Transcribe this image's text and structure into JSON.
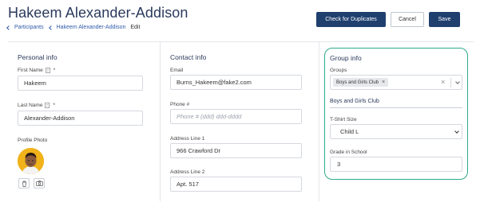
{
  "header": {
    "title": "Hakeem Alexander-Addison",
    "breadcrumb": {
      "participants": "Participants",
      "person": "Hakeem Alexander-Addison",
      "current": "Edit"
    }
  },
  "toolbar": {
    "check_duplicates": "Check for Duplicates",
    "cancel": "Cancel",
    "save": "Save"
  },
  "personal": {
    "title": "Personal info",
    "first_name_label": "First Name",
    "first_name_value": "Hakeem",
    "last_name_label": "Last Name",
    "last_name_value": "Alexander-Addison",
    "required_mark": "*",
    "photo_label": "Profile Photo"
  },
  "contact": {
    "title": "Contact info",
    "email_label": "Email",
    "email_value": "Burns_Hakeem@fake2.com",
    "phone_label": "Phone #",
    "phone_placeholder": "Phone # (ddd) ddd-dddd",
    "address1_label": "Address Line 1",
    "address1_value": "966 Crawford Dr",
    "address2_label": "Address Line 2",
    "address2_value": "Apt. 517"
  },
  "group": {
    "title": "Group info",
    "groups_label": "Groups",
    "selected_group": "Boys and Girls Club",
    "remove_mark": "×",
    "clear_mark": "×",
    "subsection_title": "Boys and Girls Club",
    "tshirt_label": "T-Shirt Size",
    "tshirt_value": "Child L",
    "grade_label": "Grade in School",
    "grade_value": "3"
  },
  "colors": {
    "primary": "#1f3f6e",
    "highlight_border": "#2daa8a",
    "link": "#2f5aa8"
  }
}
